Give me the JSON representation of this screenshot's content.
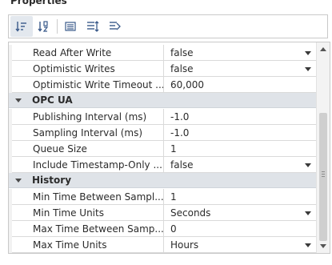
{
  "panel": {
    "title": "Properties"
  },
  "toolbar": {
    "buttons": [
      {
        "icon": "sort-categorized-icon",
        "active": true
      },
      {
        "icon": "sort-alphabetical-icon",
        "active": false
      },
      {
        "icon": "property-list-icon",
        "active": false
      },
      {
        "icon": "expand-all-icon",
        "active": false
      },
      {
        "icon": "collapse-all-icon",
        "active": false
      }
    ]
  },
  "grid": {
    "rows": [
      {
        "kind": "prop",
        "label": "Read After Write",
        "value": "false",
        "dropdown": true
      },
      {
        "kind": "prop",
        "label": "Optimistic Writes",
        "value": "false",
        "dropdown": true
      },
      {
        "kind": "prop",
        "label": "Optimistic Write Timeout ...",
        "value": "60,000",
        "dropdown": false
      },
      {
        "kind": "category",
        "label": "OPC UA"
      },
      {
        "kind": "prop",
        "label": "Publishing Interval (ms)",
        "value": "-1.0",
        "dropdown": false
      },
      {
        "kind": "prop",
        "label": "Sampling Interval (ms)",
        "value": "-1.0",
        "dropdown": false
      },
      {
        "kind": "prop",
        "label": "Queue Size",
        "value": "1",
        "dropdown": false
      },
      {
        "kind": "prop",
        "label": "Include Timestamp-Only ...",
        "value": "false",
        "dropdown": true
      },
      {
        "kind": "category",
        "label": "History"
      },
      {
        "kind": "prop",
        "label": "Min Time Between Sampl...",
        "value": "1",
        "dropdown": false
      },
      {
        "kind": "prop",
        "label": "Min Time Units",
        "value": "Seconds",
        "dropdown": true
      },
      {
        "kind": "prop",
        "label": "Max Time Between Samp...",
        "value": "0",
        "dropdown": false
      },
      {
        "kind": "prop",
        "label": "Max Time Units",
        "value": "Hours",
        "dropdown": true
      }
    ]
  },
  "colors": {
    "category_background": "#dfe3e8",
    "grid_line": "#dadada",
    "toolbar_active": "#e3e8ee"
  }
}
